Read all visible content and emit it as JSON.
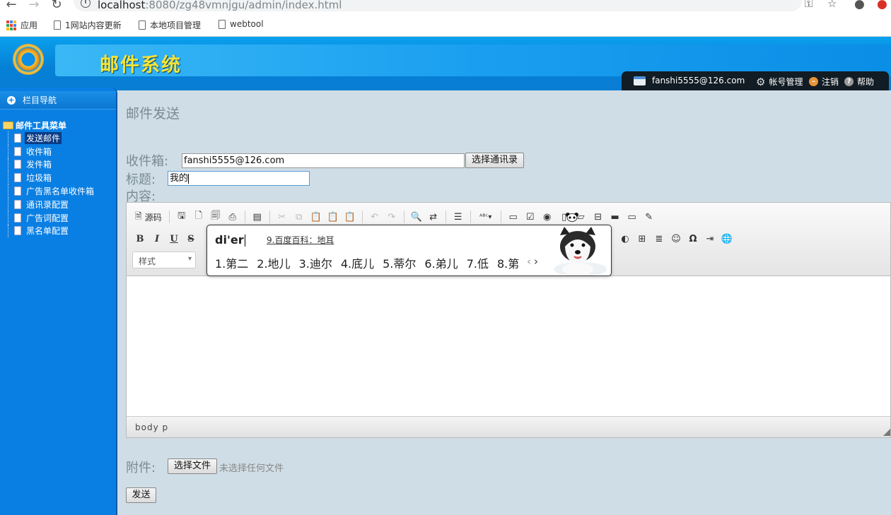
{
  "browser": {
    "url_host": "localhost",
    "url_path": ":8080/zg48vmnjgu/admin/index.html",
    "bookmarks": [
      "应用",
      "1网站内容更新",
      "本地项目管理",
      "webtool"
    ]
  },
  "header": {
    "title": "邮件系统",
    "user_email": "fanshi5555@126.com",
    "account_label": "帐号管理",
    "logout_label": "注销",
    "help_label": "帮助"
  },
  "sidebar": {
    "nav_title": "栏目导航",
    "menu_title": "邮件工具菜单",
    "items": [
      {
        "label": "发送邮件",
        "selected": true
      },
      {
        "label": "收件箱"
      },
      {
        "label": "发件箱"
      },
      {
        "label": "垃圾箱"
      },
      {
        "label": "广告黑名单收件箱"
      },
      {
        "label": "通讯录配置"
      },
      {
        "label": "广告词配置"
      },
      {
        "label": "黑名单配置"
      }
    ]
  },
  "form": {
    "heading": "邮件发送",
    "to_label": "收件箱:",
    "to_value": "fanshi5555@126.com",
    "contacts_button": "选择通讯录",
    "subject_label": "标题:",
    "subject_value": "我的",
    "content_label": "内容:",
    "attachment_label": "附件:",
    "choose_file_button": "选择文件",
    "no_file_text": "未选择任何文件",
    "send_button": "发送"
  },
  "editor": {
    "source_label": "源码",
    "style_combo": "样式",
    "path_text": "body  p",
    "format_buttons": [
      "B",
      "I",
      "U",
      "S"
    ]
  },
  "ime": {
    "input": "di'er",
    "baike": "9.百度百科：地耳",
    "candidates": [
      "1.第二",
      "2.地儿",
      "3.迪尔",
      "4.底儿",
      "5.蒂尔",
      "6.弟儿",
      "7.低",
      "8.第"
    ]
  },
  "colors": {
    "banner": "#0a8ee6",
    "sidebar": "#0a7fe3",
    "title_yellow": "#f5e23a",
    "content_bg": "#cfdde6"
  }
}
